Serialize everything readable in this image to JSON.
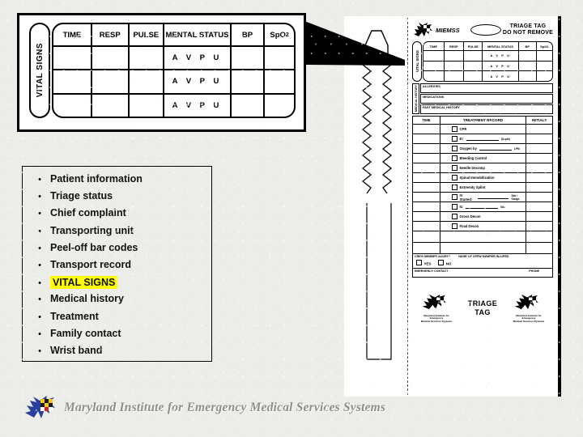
{
  "colors": {
    "background": "#ecece9",
    "highlight": "#ffff00",
    "ink": "#000000",
    "footer_text": "#8e8e8e",
    "logo_blue": "#2b3f9e",
    "logo_red": "#d22027",
    "logo_gold": "#f5c518"
  },
  "callout": {
    "title": "VITAL SIGNS",
    "side_label": "VITAL SIGNS",
    "columns": [
      "TIME",
      "RESP",
      "PULSE",
      "MENTAL STATUS",
      "BP",
      "SpO"
    ],
    "spo2_subscript": "2",
    "rows": [
      {
        "mental_status": "A V P U"
      },
      {
        "mental_status": "A V P U"
      },
      {
        "mental_status": "A V P U"
      }
    ]
  },
  "bullets": {
    "items": [
      {
        "label": "Patient information",
        "highlight": false
      },
      {
        "label": "Triage status",
        "highlight": false
      },
      {
        "label": "Chief complaint",
        "highlight": false
      },
      {
        "label": "Transporting unit",
        "highlight": false
      },
      {
        "label": "Peel-off bar codes",
        "highlight": false
      },
      {
        "label": "Transport record",
        "highlight": false
      },
      {
        "label": "VITAL SIGNS",
        "highlight": true
      },
      {
        "label": "Medical history",
        "highlight": false
      },
      {
        "label": "Treatment",
        "highlight": false
      },
      {
        "label": "Family contact",
        "highlight": false
      },
      {
        "label": "Wrist band",
        "highlight": false
      }
    ],
    "bullet_glyph": "•"
  },
  "form": {
    "header": {
      "brand": "MIEMSS",
      "title_line1": "TRIAGE TAG",
      "title_line2": "DO NOT REMOVE"
    },
    "vitals": {
      "side_label": "VITAL SIGNS",
      "columns": [
        "TIME",
        "RESP",
        "PULSE",
        "MENTAL STATUS",
        "BP",
        "SpO2"
      ],
      "rows": [
        {
          "mental_status": "A V P U"
        },
        {
          "mental_status": "A V P U"
        },
        {
          "mental_status": "A V P U"
        }
      ]
    },
    "medical_history": {
      "side_label": "MEDICAL HISTORY",
      "rows": [
        "ALLERGIES",
        "MEDICATIONS",
        "PAST MEDICAL HISTORY"
      ]
    },
    "treatment": {
      "col_time": "TIME",
      "col_title": "TREATMENT RECORD",
      "col_initials": "INITIALS",
      "items": [
        {
          "label": "CPR",
          "trailing": ""
        },
        {
          "label": "ET",
          "trailing": "(Depth)"
        },
        {
          "label": "Oxygen by",
          "trailing": "LPM"
        },
        {
          "label": "Bleeding Control",
          "trailing": ""
        },
        {
          "label": "Needle Decomp",
          "trailing": ""
        },
        {
          "label": "Spinal Immobilization",
          "trailing": ""
        },
        {
          "label": "Extremity Splint",
          "trailing": ""
        },
        {
          "label": "IV Started:",
          "trailing": "Site / Gauge"
        },
        {
          "label": "IO",
          "trailing": "Site"
        },
        {
          "label": "Gross Decon",
          "trailing": ""
        },
        {
          "label": "Final Decon",
          "trailing": ""
        }
      ]
    },
    "crew": {
      "label_left": "CREW MEMBER INJURY?",
      "label_right": "NAME OF CREW MEMBER INJURED",
      "yes": "YES",
      "no": "NO",
      "contact_label": "EMERGENCY CONTACT",
      "phone_label": "PHONE"
    },
    "bottom": {
      "title_line1": "TRIAGE",
      "title_line2": "TAG",
      "logo_caption_line1": "Maryland Institute for Emergency",
      "logo_caption_line2": "Medical Services Systems"
    }
  },
  "footer": {
    "text": "Maryland Institute for Emergency Medical Services Systems"
  }
}
